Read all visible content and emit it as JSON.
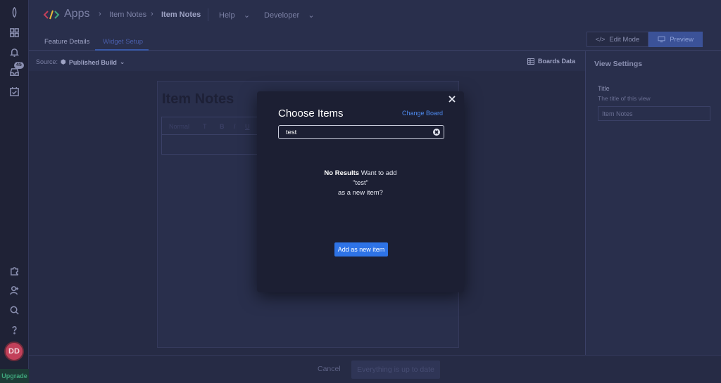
{
  "rail": {
    "inbox_badge": "45",
    "avatar_initials": "DD",
    "upgrade_label": "Upgrade"
  },
  "header": {
    "app_title": "Apps",
    "breadcrumbs": [
      "Item Notes",
      "Item Notes"
    ],
    "nav": [
      "Help",
      "Developer"
    ]
  },
  "tabs": [
    {
      "label": "Feature Details",
      "active": false
    },
    {
      "label": "Widget Setup",
      "active": true
    }
  ],
  "mode": {
    "edit_label": "Edit Mode",
    "preview_label": "Preview"
  },
  "source": {
    "label": "Source:",
    "value": "Published Build",
    "boards_data": "Boards Data"
  },
  "widget": {
    "title": "Item Notes",
    "toolbar": [
      "Normal",
      "T",
      "B",
      "I",
      "U"
    ]
  },
  "view_settings": {
    "title": "View Settings",
    "field_label": "Title",
    "field_help": "The title of this view",
    "field_placeholder": "Item Notes"
  },
  "footer": {
    "cancel": "Cancel",
    "status": "Everything is up to date"
  },
  "modal": {
    "title": "Choose Items",
    "change_board": "Change Board",
    "search_value": "test",
    "no_results_bold": "No Results",
    "no_results_text": "Want to add",
    "quoted_term": "\"test\"",
    "suffix": "as a new item?",
    "add_button": "Add as new item"
  },
  "colors": {
    "accent": "#2e73e6",
    "link": "#4e8bf0",
    "background": "#292f4c",
    "modal": "#1c1f33",
    "avatar": "#c2405a",
    "upgrade": "#3fa77d"
  }
}
